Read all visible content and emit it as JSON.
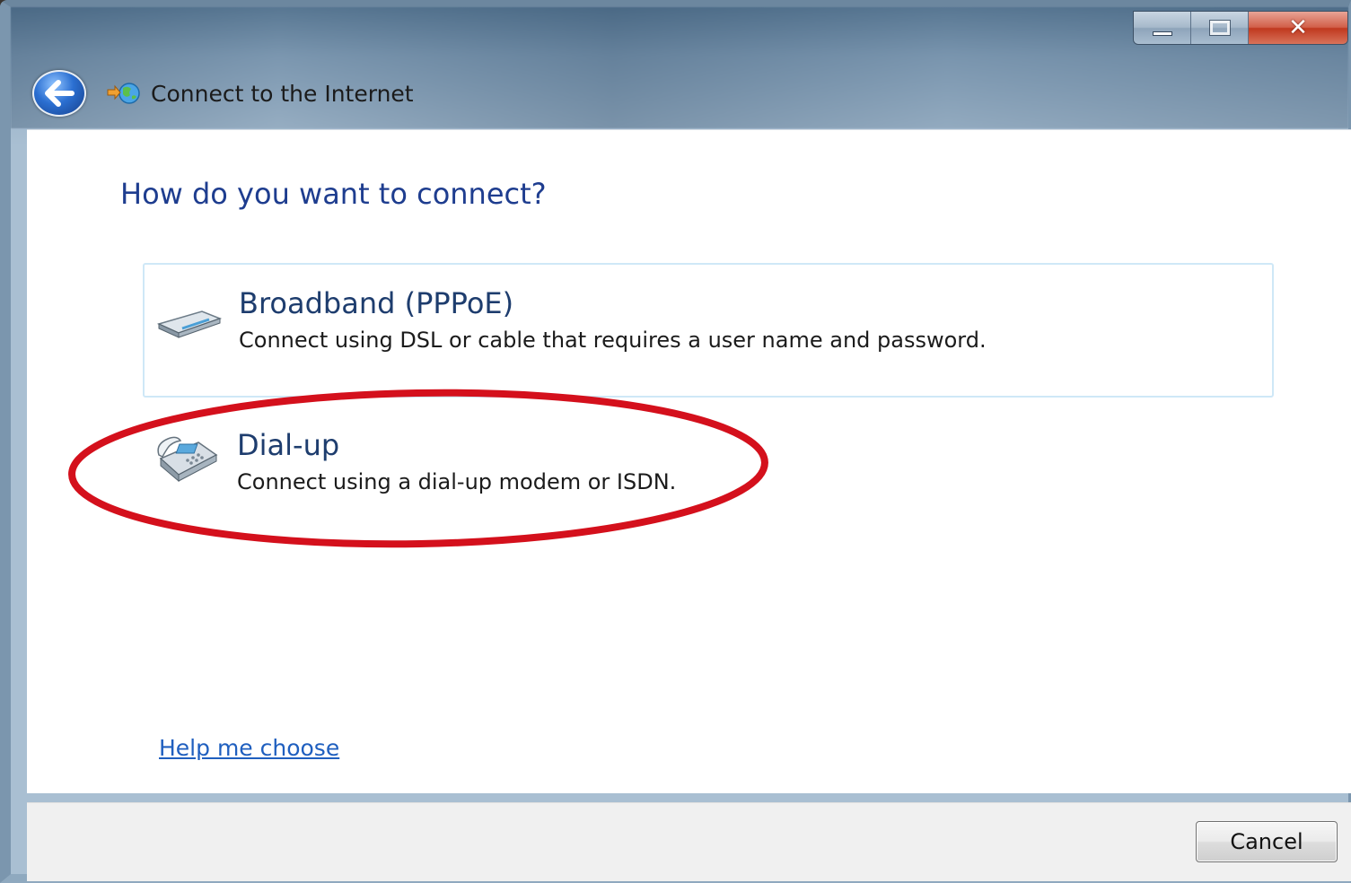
{
  "window": {
    "title": "Connect to the Internet",
    "caption": {
      "minimize": "minimize",
      "maximize": "maximize",
      "close": "close"
    }
  },
  "main": {
    "heading": "How do you want to connect?",
    "options": [
      {
        "title": "Broadband (PPPoE)",
        "description": "Connect using DSL or cable that requires a user name and password.",
        "icon": "modem-icon",
        "highlighted": true
      },
      {
        "title": "Dial-up",
        "description": "Connect using a dial-up modem or ISDN.",
        "icon": "phone-icon",
        "highlighted": false
      }
    ],
    "help_link": "Help me choose"
  },
  "footer": {
    "cancel_label": "Cancel"
  },
  "colors": {
    "heading": "#1e3d8f",
    "link": "#1f5fbf",
    "annotation": "#d4101c",
    "highlight_border": "#cfe8f7"
  }
}
